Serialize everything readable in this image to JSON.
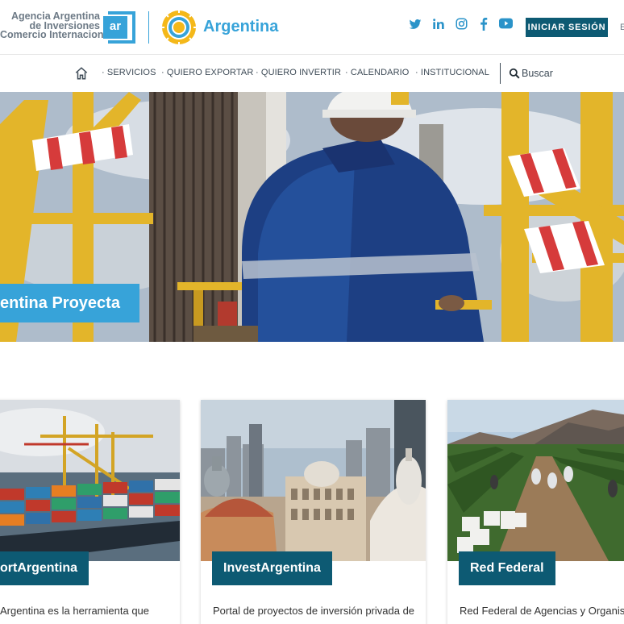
{
  "header": {
    "agency_lines": [
      "Agencia Argentina",
      "de Inversiones",
      "Comercio Internacional"
    ],
    "agency_logo_text": "ar",
    "country_label": "Argentina",
    "social_icons": [
      "twitter-icon",
      "linkedin-icon",
      "instagram-icon",
      "facebook-icon",
      "youtube-icon"
    ],
    "login_label": "INICIAR SESIÓN",
    "language_label": "E"
  },
  "nav": {
    "items": [
      {
        "label": "· SERVICIOS"
      },
      {
        "label": "· QUIERO EXPORTAR"
      },
      {
        "label": "· QUIERO INVERTIR"
      },
      {
        "label": "· CALENDARIO"
      },
      {
        "label": "· INSTITUCIONAL"
      }
    ],
    "search_label": "Buscar"
  },
  "hero": {
    "caption": "entina Proyecta"
  },
  "cards": [
    {
      "title": "ortArgentina",
      "text": "Argentina es la herramienta que"
    },
    {
      "title": "InvestArgentina",
      "text": "Portal de proyectos de inversión privada de"
    },
    {
      "title": "Red Federal",
      "text": "Red Federal de Agencias y Organism"
    }
  ],
  "colors": {
    "primary_blue": "#37a3d9",
    "dark_teal": "#0d5a73",
    "text_gray": "#3d4a56"
  }
}
